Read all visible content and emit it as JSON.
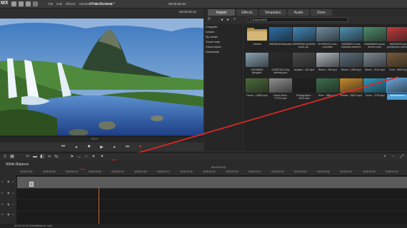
{
  "app": {
    "logo_text": "MX"
  },
  "menu": [
    "File",
    "Edit",
    "Effects",
    "Window",
    "Share",
    "Help"
  ],
  "preview": {
    "project_title": "White Balance *",
    "time_left": "00:00:00:18",
    "time_right": "00:00:03:13",
    "ruler_mark": "00:10"
  },
  "media_pool": {
    "tabs": [
      {
        "label": "Import",
        "active": true
      },
      {
        "label": "Effects",
        "active": false
      },
      {
        "label": "Templates",
        "active": false
      },
      {
        "label": "Audio",
        "active": false
      },
      {
        "label": "Store",
        "active": false
      }
    ],
    "path": "C:\\Users\\WM",
    "tree": [
      "Computer",
      "Iceland",
      "My media",
      "Travel route",
      "Cloud Import",
      "Downloads"
    ],
    "items": [
      {
        "label": "Iceland",
        "kind": "folder",
        "color": "#c7a867"
      },
      {
        "label": "4883460301fbcuaSaaeqbrdTrieunp...",
        "kind": "video",
        "color": "#2a6fa8"
      },
      {
        "label": "5800990901.jfo3i2ierspine-surfer-pa...",
        "kind": "video",
        "color": "#3f86b8"
      },
      {
        "label": "5979991221-nice-mountain-breathtaking...",
        "kind": "video",
        "color": "#6f8ca0"
      },
      {
        "label": "6089892071-nice-mountain-extreme-wh...",
        "kind": "video",
        "color": "#4d90b0"
      },
      {
        "label": "8365858000-aerial-dronee-shot-beautifu...",
        "kind": "video",
        "color": "#4d8c6a"
      },
      {
        "label": "8480000001-jet-perspective-nomad...",
        "kind": "video",
        "color": "#c23a3a"
      },
      {
        "label": "106028808-flyingace-beachatlantic-...",
        "kind": "video",
        "color": "#8aa3b3"
      },
      {
        "label": "1228071631-big-opening-pan-around...",
        "kind": "video",
        "color": "#2c2c2c"
      },
      {
        "label": "Airplane - 300.mp4",
        "kind": "video",
        "color": "#4a4a4a"
      },
      {
        "label": "Beach - 189.mp4",
        "kind": "video",
        "color": "#b0b7bd"
      },
      {
        "label": "Beach - 1255.mp4",
        "kind": "video",
        "color": "#5e6d79"
      },
      {
        "label": "Beach - 3112.mp4",
        "kind": "video",
        "color": "#7c8a90"
      },
      {
        "label": "Cook - 9849.mp4",
        "kind": "video",
        "color": "#7a5a3a"
      },
      {
        "label": "Fauna - 13663.mp4",
        "kind": "video",
        "color": "#4b6b3a"
      },
      {
        "label": "Grand Ulsen - 27724.mp4",
        "kind": "video",
        "color": "#8f8f8f"
      },
      {
        "label": "Photographer - 2041.mp4",
        "kind": "video",
        "color": "#1f1f1f"
      },
      {
        "label": "River - 5862.mp4",
        "kind": "video",
        "color": "#3a6d4a"
      },
      {
        "label": "Sunset - 25870.mp4",
        "kind": "video",
        "color": "#c78a2a"
      },
      {
        "label": "Tulum - 7278.mp4",
        "kind": "video",
        "color": "#2f9ac0"
      },
      {
        "label": "WhiteBalance...",
        "kind": "video",
        "color": "#6aa6d8",
        "selected": true
      }
    ]
  },
  "timeline": {
    "title": "White Balance",
    "timecode": "00:00:03:13",
    "ruler_labels": [
      "00:00:00:00",
      "00:00:00:06",
      "00:00:00:12",
      "00:00:00:18",
      "00:00:01:00",
      "00:00:01:06",
      "00:00:01:12",
      "00:00:01:18",
      "00:00:02:00",
      "00:00:02:06",
      "00:00:02:12",
      "00:00:02:18",
      "00:00:03:00",
      "00:00:03:06",
      "00:00:03:12",
      "00:00:03:18",
      "00:00:04:00"
    ],
    "track_numbers": [
      "1",
      "2",
      "3",
      "4",
      "5"
    ]
  },
  "status": {
    "text": "00:00:00:00  WhiteBalance.mp4"
  },
  "colors": {
    "arrow": "#d62828",
    "playhead": "#c46a2a",
    "selected": "#4a9fd8"
  }
}
